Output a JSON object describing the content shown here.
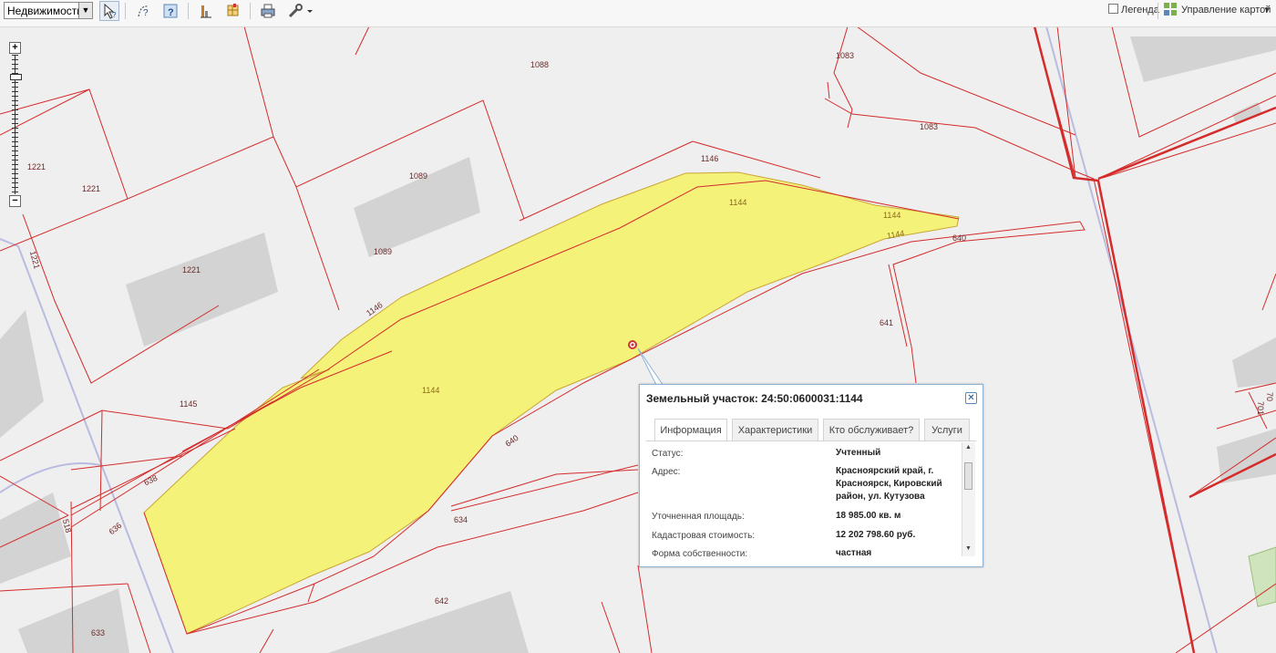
{
  "toolbar": {
    "layer_select_value": "Недвижимость",
    "legend_label": "Легенда",
    "map_control_label": "Управление картой",
    "icons": [
      "select-arrow-icon",
      "identify-icon",
      "help-query-icon",
      "measure-icon",
      "layers-icon",
      "print-icon",
      "tools-icon"
    ]
  },
  "zoom": {
    "plus": "+",
    "minus": "−"
  },
  "map": {
    "colors": {
      "boundary": "#d42b2b",
      "highlight_fill": "#f5f27a",
      "highlight_stroke": "#c9a633",
      "building": "#d3d3d3",
      "road": "#b9bbe0",
      "background": "#efefef"
    },
    "labels": [
      "1088",
      "1083",
      "1083",
      "1221",
      "1221",
      "1221",
      "1221",
      "1089",
      "1089",
      "1146",
      "1146",
      "1144",
      "1144",
      "1144",
      "1144",
      "640",
      "640",
      "641",
      "1145",
      "638",
      "636",
      "518",
      "634",
      "642",
      "633",
      "701",
      "70"
    ]
  },
  "popup": {
    "title": "Земельный участок: 24:50:0600031:1144",
    "close_label": "✕",
    "tabs": [
      "Информация",
      "Характеристики",
      "Кто обслуживает?",
      "Услуги"
    ],
    "rows": [
      {
        "label": "Статус:",
        "value": "Учтенный"
      },
      {
        "label": "Адрес:",
        "value": "Красноярский край, г. Красноярск, Кировский район, ул. Кутузова"
      },
      {
        "label": "Уточненная площадь:",
        "value": "18 985.00 кв. м"
      },
      {
        "label": "Кадастровая стоимость:",
        "value": "12 202 798.60 руб."
      },
      {
        "label": "Форма собственности:",
        "value": "частная"
      }
    ]
  }
}
